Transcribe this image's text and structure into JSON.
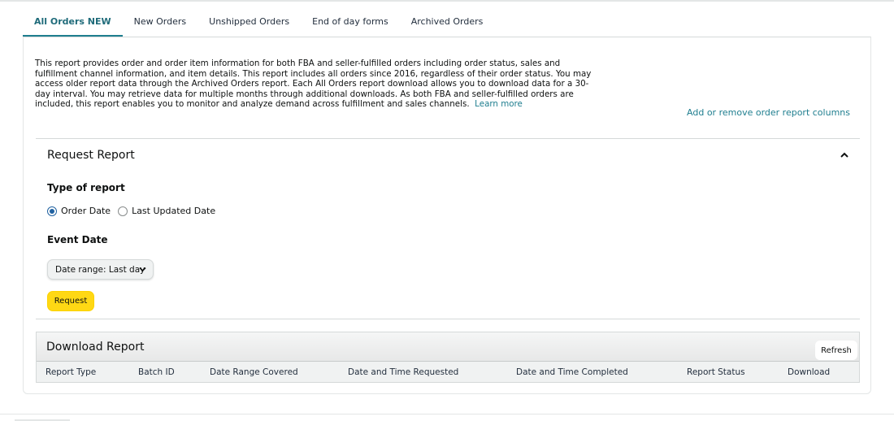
{
  "tabs": [
    {
      "label": "All Orders NEW",
      "active": true
    },
    {
      "label": "New Orders",
      "active": false
    },
    {
      "label": "Unshipped Orders",
      "active": false
    },
    {
      "label": "End of day forms",
      "active": false
    },
    {
      "label": "Archived Orders",
      "active": false
    }
  ],
  "description": {
    "text": "This report provides order and order item information for both FBA and seller-fulfilled orders including order status, sales and fulfillment channel information, and item details. This report includes all orders since 2016, regardless of their order status. You may access older report data through the Archived Orders report. Each All Orders report download allows you to download data for a 30-day interval. You may retrieve data for multiple months through additional downloads. As both FBA and seller-fulfilled orders are included, this report enables you to monitor and analyze demand across fulfillment and sales channels.",
    "learn_more": "Learn more"
  },
  "columns_link": "Add or remove order report columns",
  "request_report": {
    "title": "Request Report",
    "type_label": "Type of report",
    "radio_options": [
      {
        "label": "Order Date",
        "checked": true
      },
      {
        "label": "Last Updated Date",
        "checked": false
      }
    ],
    "event_date_label": "Event Date",
    "date_range_selected": "Date range: Last day",
    "request_button": "Request"
  },
  "download_report": {
    "title": "Download Report",
    "refresh_button": "Refresh",
    "columns": [
      "Report Type",
      "Batch ID",
      "Date Range Covered",
      "Date and Time Requested",
      "Date and Time Completed",
      "Report Status",
      "Download"
    ]
  },
  "colors": {
    "accent_teal": "#1f7e8f",
    "request_yellow": "#ffd814",
    "radio_blue": "#2162a1"
  }
}
